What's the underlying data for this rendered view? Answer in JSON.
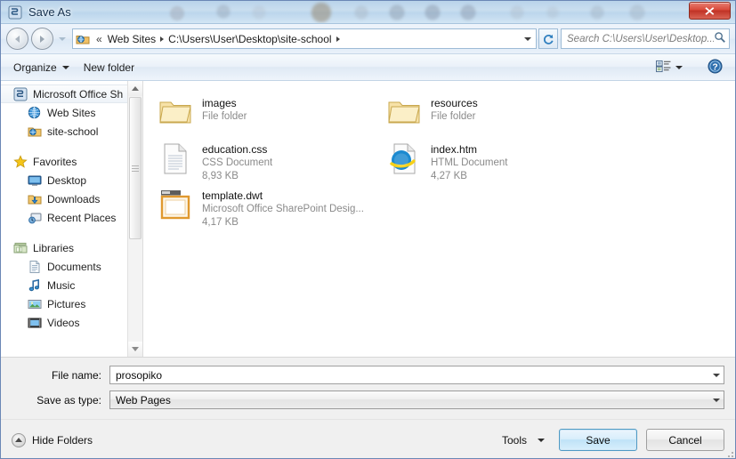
{
  "window": {
    "title": "Save As",
    "close_label": "✕"
  },
  "nav": {
    "back_tooltip": "Back",
    "forward_tooltip": "Forward",
    "breadcrumb": {
      "overflow": "«",
      "items": [
        "Web Sites",
        "C:\\Users\\User\\Desktop\\site-school"
      ]
    },
    "refresh_label": "Refresh",
    "search_placeholder": "Search C:\\Users\\User\\Desktop..."
  },
  "toolbar": {
    "organize_label": "Organize",
    "new_folder_label": "New folder",
    "view_label": "Change your view",
    "help_label": "?"
  },
  "sidebar": {
    "groups": [
      {
        "header": {
          "label": "Microsoft Office Sh",
          "icon": "sharepoint-designer-icon",
          "selected": true
        },
        "items": [
          {
            "label": "Web Sites",
            "icon": "globe-icon"
          },
          {
            "label": "site-school",
            "icon": "web-folder-icon"
          }
        ]
      },
      {
        "header": {
          "label": "Favorites",
          "icon": "star-icon",
          "selected": false
        },
        "items": [
          {
            "label": "Desktop",
            "icon": "desktop-icon"
          },
          {
            "label": "Downloads",
            "icon": "downloads-icon"
          },
          {
            "label": "Recent Places",
            "icon": "recent-places-icon"
          }
        ]
      },
      {
        "header": {
          "label": "Libraries",
          "icon": "libraries-icon",
          "selected": false
        },
        "items": [
          {
            "label": "Documents",
            "icon": "documents-icon"
          },
          {
            "label": "Music",
            "icon": "music-icon"
          },
          {
            "label": "Pictures",
            "icon": "pictures-icon"
          },
          {
            "label": "Videos",
            "icon": "videos-icon"
          }
        ]
      }
    ]
  },
  "files": [
    {
      "name": "images",
      "type": "File folder",
      "size": "",
      "icon": "folder-icon"
    },
    {
      "name": "resources",
      "type": "File folder",
      "size": "",
      "icon": "folder-icon"
    },
    {
      "name": "education.css",
      "type": "CSS Document",
      "size": "8,93 KB",
      "icon": "css-file-icon"
    },
    {
      "name": "index.htm",
      "type": "HTML Document",
      "size": "4,27 KB",
      "icon": "internet-explorer-icon"
    },
    {
      "name": "template.dwt",
      "type": "Microsoft Office SharePoint Desig...",
      "size": "4,17 KB",
      "icon": "dwt-template-icon"
    }
  ],
  "form": {
    "filename_label": "File name:",
    "filename_value": "prosopiko",
    "filetype_label": "Save as type:",
    "filetype_value": "Web Pages"
  },
  "footer": {
    "hide_folders_label": "Hide Folders",
    "tools_label": "Tools",
    "save_label": "Save",
    "cancel_label": "Cancel"
  },
  "colors": {
    "accent_blue": "#4f9ac4",
    "close_red": "#c03225",
    "title_text": "#15314e",
    "meta_gray": "#8a8a8a"
  }
}
